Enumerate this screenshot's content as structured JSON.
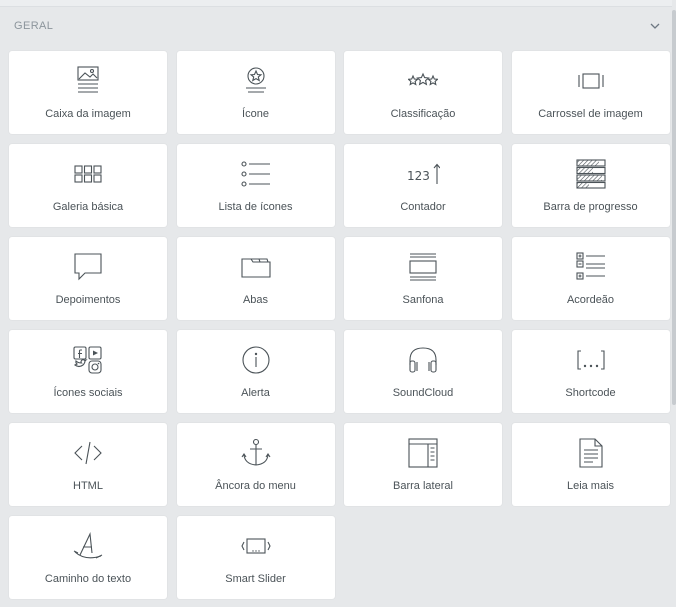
{
  "section": {
    "title": "GERAL",
    "toggle_icon": "chevron-down-icon"
  },
  "widgets": [
    {
      "label": "Caixa da imagem",
      "icon": "image-box-icon"
    },
    {
      "label": "Ícone",
      "icon": "icon-widget-icon"
    },
    {
      "label": "Classificação",
      "icon": "star-rating-icon"
    },
    {
      "label": "Carrossel de imagem",
      "icon": "image-carousel-icon"
    },
    {
      "label": "Galeria básica",
      "icon": "gallery-grid-icon"
    },
    {
      "label": "Lista de ícones",
      "icon": "icon-list-icon"
    },
    {
      "label": "Contador",
      "icon": "counter-icon"
    },
    {
      "label": "Barra de progresso",
      "icon": "progress-bar-icon"
    },
    {
      "label": "Depoimentos",
      "icon": "testimonial-icon"
    },
    {
      "label": "Abas",
      "icon": "tabs-icon"
    },
    {
      "label": "Sanfona",
      "icon": "accordion-icon"
    },
    {
      "label": "Acordeão",
      "icon": "toggle-icon"
    },
    {
      "label": "Ícones sociais",
      "icon": "social-icons-icon"
    },
    {
      "label": "Alerta",
      "icon": "alert-icon"
    },
    {
      "label": "SoundCloud",
      "icon": "headphones-icon"
    },
    {
      "label": "Shortcode",
      "icon": "shortcode-icon"
    },
    {
      "label": "HTML",
      "icon": "code-icon"
    },
    {
      "label": "Âncora do menu",
      "icon": "anchor-icon"
    },
    {
      "label": "Barra lateral",
      "icon": "sidebar-icon"
    },
    {
      "label": "Leia mais",
      "icon": "read-more-icon"
    },
    {
      "label": "Caminho do texto",
      "icon": "text-path-icon"
    },
    {
      "label": "Smart Slider",
      "icon": "smart-slider-icon"
    }
  ]
}
